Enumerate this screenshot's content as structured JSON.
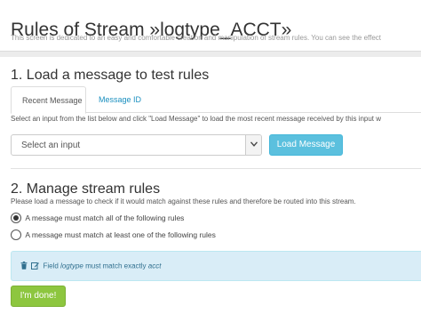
{
  "header": {
    "title": "Rules of Stream »logtype_ACCT»",
    "description": "This screen is dedicated to an easy and comfortable creation and manipulation of stream rules. You can see the effect"
  },
  "load_section": {
    "title": "1. Load a message to test rules",
    "tabs": [
      {
        "label": "Recent Message",
        "active": true
      },
      {
        "label": "Message ID",
        "active": false
      }
    ],
    "help": "Select an input from the list below and click \"Load Message\" to load the most recent message received by this input w",
    "input_select": {
      "value": "Select an input"
    },
    "load_button": "Load Message"
  },
  "rules_section": {
    "title": "2. Manage stream rules",
    "help": "Please load a message to check if it would match against these rules and therefore be routed into this stream.",
    "match_options": [
      {
        "label": "A message must match all of the following rules",
        "checked": true
      },
      {
        "label": "A message must match at least one of the following rules",
        "checked": false
      }
    ],
    "rules": [
      {
        "prefix": "Field",
        "field": "logtype",
        "condition": "must match exactly",
        "value": "acct"
      }
    ],
    "done_button": "I'm done!"
  },
  "colors": {
    "info_button": "#5bc0de",
    "success_button": "#8dc63f",
    "rule_box_bg": "#d9edf7",
    "rule_text": "#31708f",
    "tab_link": "#1a8fbf"
  },
  "icons": {
    "delete": "trash-icon",
    "edit": "edit-icon",
    "select_arrow": "chevron-down-icon"
  }
}
